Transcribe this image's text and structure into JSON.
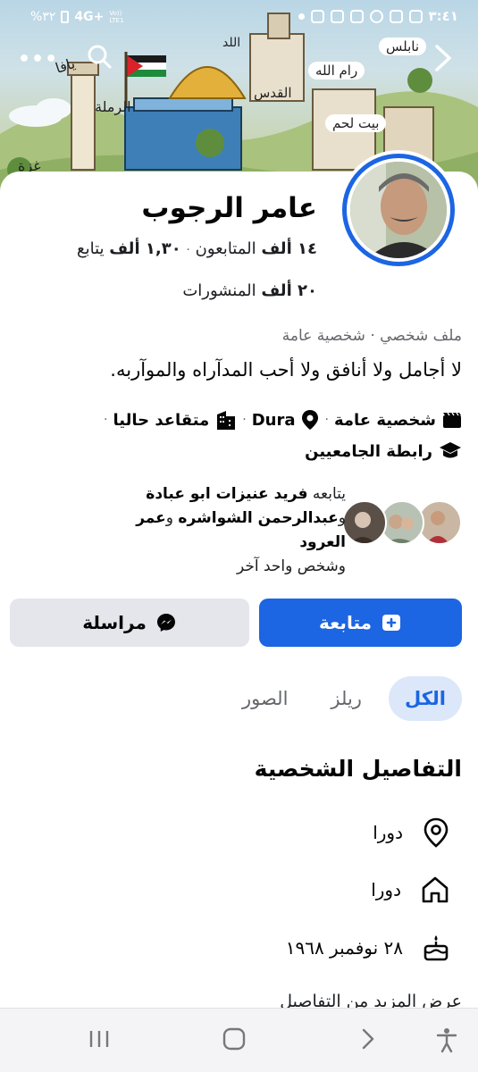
{
  "status_bar": {
    "time": "٣:٤١",
    "battery": "%٣٢",
    "network": "4G+",
    "network_sub": "Vo)) LTE1"
  },
  "profile": {
    "name": "عامر الرجوب",
    "followers_count": "١٤ ألف",
    "followers_label": "المتابعون",
    "following_count": "١,٣٠ ألف",
    "following_label": "يتابع",
    "posts_count": "٢٠ ألف",
    "posts_label": "المنشورات",
    "category": "ملف شخصي · شخصية عامة",
    "bio": "لا أجامل ولا أنافق ولا أحب المدآراه والموآربه."
  },
  "facts": {
    "public_figure": "شخصية عامة",
    "location": "Dura",
    "status": "متقاعد حاليا",
    "education": "رابطة الجامعيين",
    "separator": "·"
  },
  "mutual": {
    "prefix": "يتابعه",
    "name1": "فريد عنيزات ابو عبادة",
    "conj1": "و",
    "name2": "عبدالرحمن الشواشره",
    "conj2": "و",
    "name3": "عمر العرود",
    "suffix": "وشخص واحد آخر"
  },
  "buttons": {
    "follow": "متابعة",
    "message": "مراسلة"
  },
  "tabs": [
    {
      "label": "الكل",
      "active": true
    },
    {
      "label": "ريلز",
      "active": false
    },
    {
      "label": "الصور",
      "active": false
    }
  ],
  "details": {
    "title": "التفاصيل الشخصية",
    "location": "دورا",
    "hometown": "دورا",
    "birthday": "٢٨ نوفمبر ١٩٦٨",
    "more": "عرض المزيد من التفاصيل"
  },
  "cover_labels": [
    "يافا",
    "اللد",
    "نابلس",
    "رام الله",
    "القدس",
    "الرملة",
    "بيت لحم",
    "غزة"
  ],
  "colors": {
    "accent": "#1c65e3",
    "tab_active_bg": "#dce8f9",
    "secondary_button": "#e4e6eb",
    "muted_text": "#65676b"
  }
}
